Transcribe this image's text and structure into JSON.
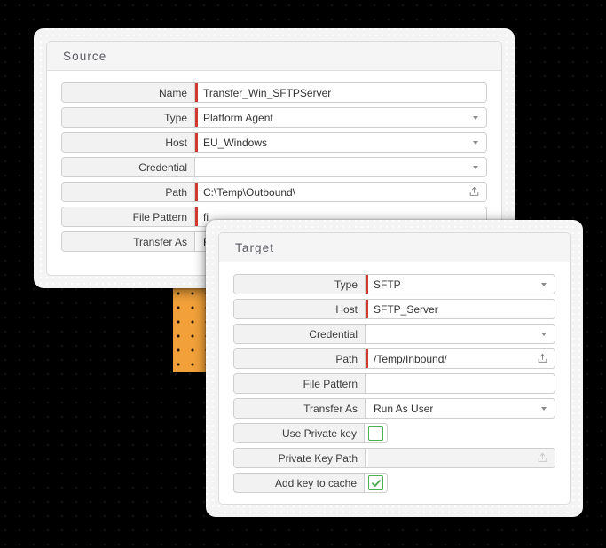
{
  "background": {
    "color": "#000000",
    "accent_block_color": "#F2A13A"
  },
  "source": {
    "title": "Source",
    "fields": [
      {
        "label": "Name",
        "value": "Transfer_Win_SFTPServer",
        "required": true,
        "control": "text"
      },
      {
        "label": "Type",
        "value": "Platform Agent",
        "required": true,
        "control": "select"
      },
      {
        "label": "Host",
        "value": "EU_Windows",
        "required": true,
        "control": "select"
      },
      {
        "label": "Credential",
        "value": "",
        "required": false,
        "control": "select"
      },
      {
        "label": "Path",
        "value": "C:\\Temp\\Outbound\\",
        "required": true,
        "control": "path"
      },
      {
        "label": "File Pattern",
        "value": "fi",
        "required": true,
        "control": "text"
      },
      {
        "label": "Transfer As",
        "value": "R",
        "required": false,
        "control": "select"
      }
    ]
  },
  "target": {
    "title": "Target",
    "fields": [
      {
        "label": "Type",
        "value": "SFTP",
        "required": true,
        "control": "select"
      },
      {
        "label": "Host",
        "value": "SFTP_Server",
        "required": true,
        "control": "text"
      },
      {
        "label": "Credential",
        "value": "",
        "required": false,
        "control": "select"
      },
      {
        "label": "Path",
        "value": "/Temp/Inbound/",
        "required": true,
        "control": "path"
      },
      {
        "label": "File Pattern",
        "value": "",
        "required": false,
        "control": "text"
      },
      {
        "label": "Transfer As",
        "value": "Run As User",
        "required": false,
        "control": "select"
      },
      {
        "label": "Use Private key",
        "value": "",
        "required": false,
        "control": "checkbox",
        "checked": false
      },
      {
        "label": "Private Key Path",
        "value": "",
        "required": false,
        "control": "path-readonly"
      },
      {
        "label": "Add key to cache",
        "value": "",
        "required": false,
        "control": "checkbox",
        "checked": true
      }
    ]
  },
  "icons": {
    "upload": "upload-icon",
    "dropdown": "chevron-down-icon",
    "check": "check-icon"
  }
}
